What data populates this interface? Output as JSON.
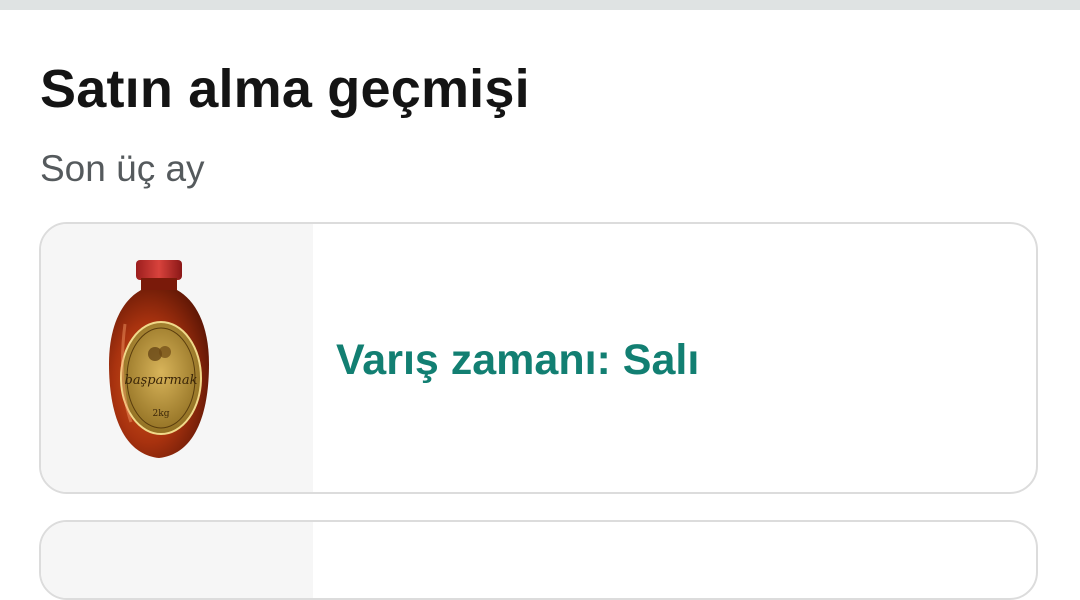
{
  "header": {
    "title": "Satın alma geçmişi",
    "subtitle": "Son üç ay"
  },
  "orders": [
    {
      "product_image": "honey-bottle-image",
      "product_label_text": "başparmak",
      "product_weight_text": "2kg",
      "arrival_text": "Varış zamanı: Salı"
    }
  ],
  "colors": {
    "accent": "#127f72",
    "title": "#141414",
    "subtitle": "#555a5d",
    "card_border": "#dcdcdc"
  }
}
